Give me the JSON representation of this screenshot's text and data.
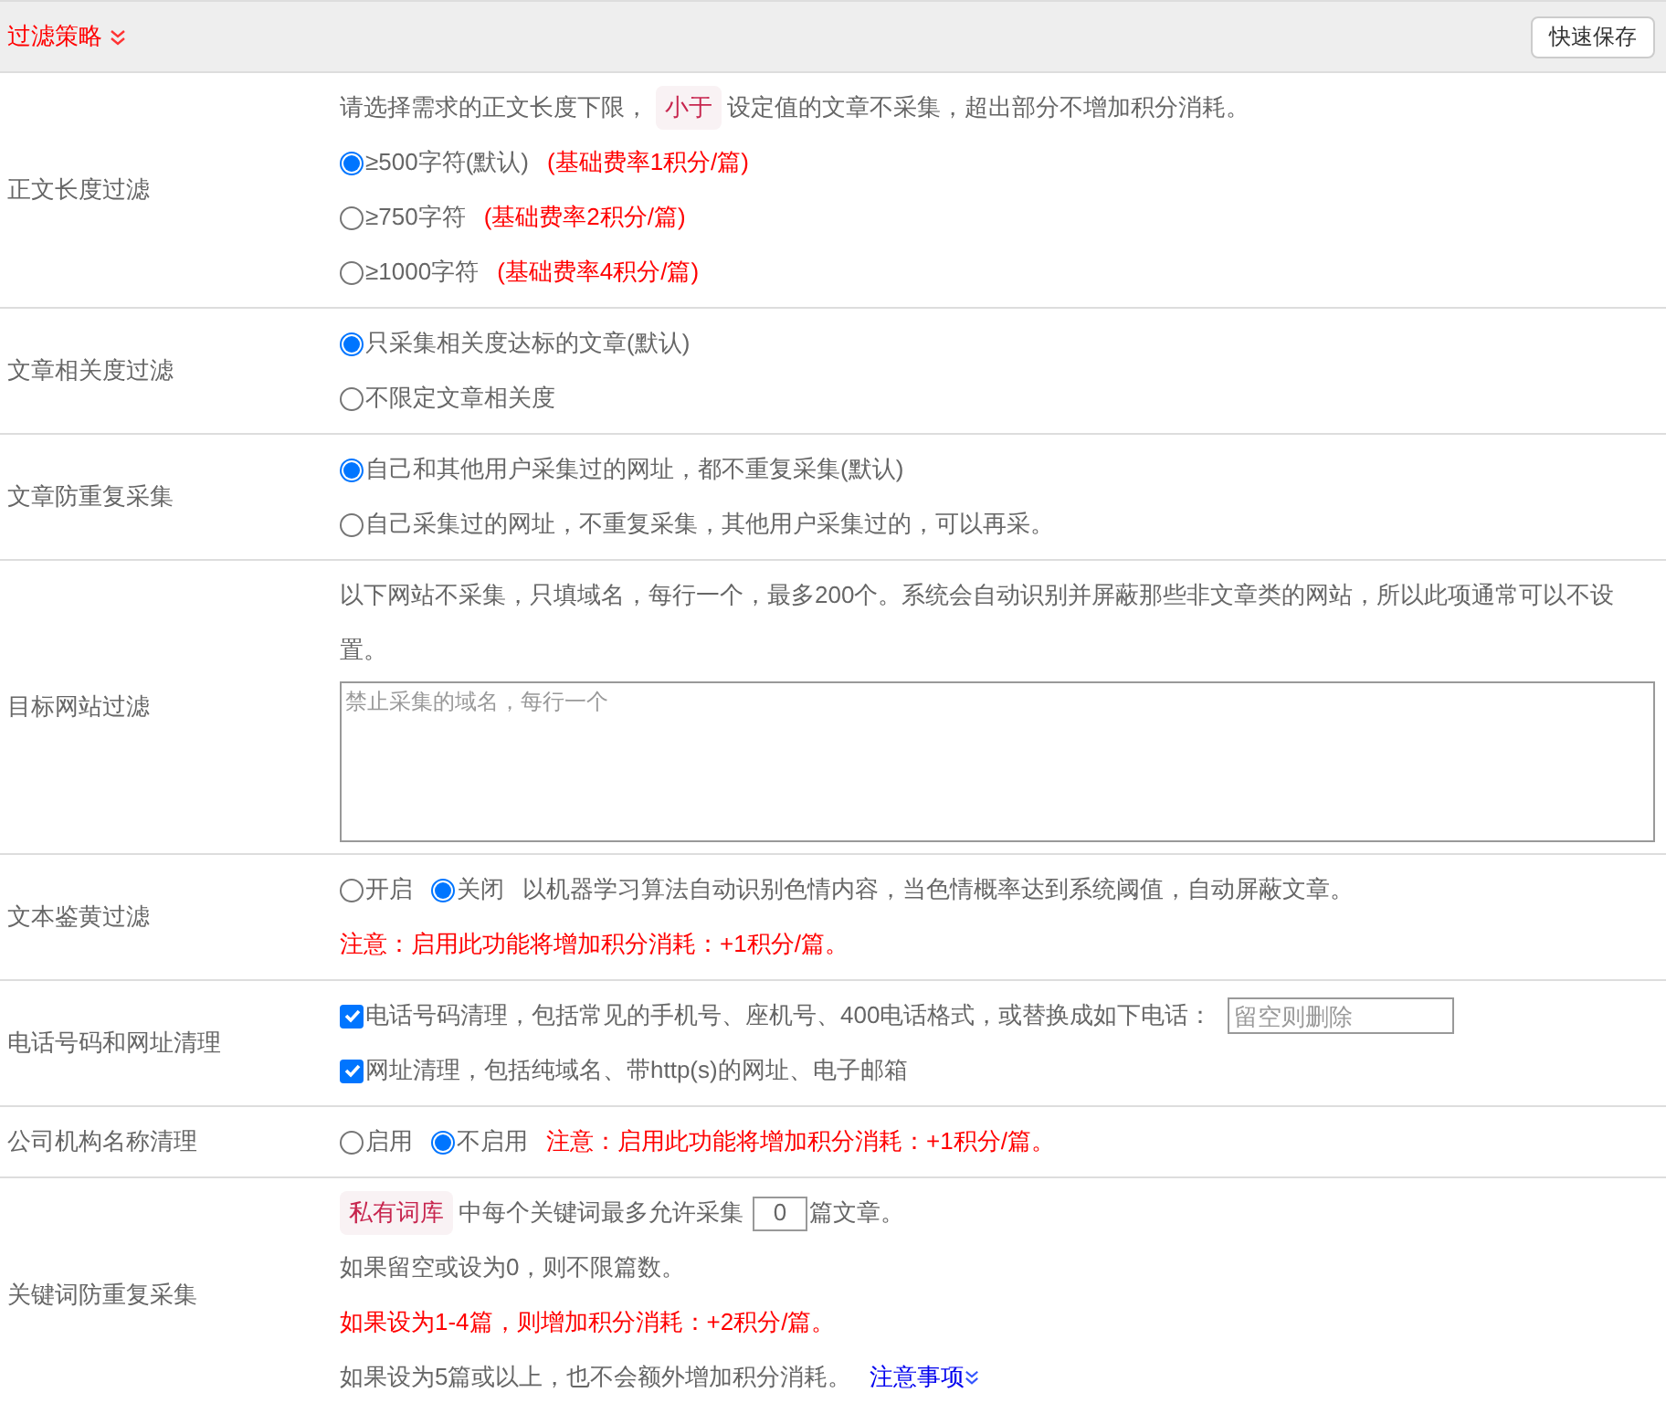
{
  "header": {
    "title": "过滤策略",
    "button": "快速保存"
  },
  "rows": [
    {
      "label": "正文长度过滤",
      "lines": [
        [
          {
            "kind": "text",
            "text": "请选择需求的正文长度下限，"
          },
          {
            "kind": "tag",
            "text": "小于"
          },
          {
            "kind": "text",
            "text": "设定值的文章不采集，超出部分不增加积分消耗。"
          }
        ],
        [
          {
            "kind": "radio",
            "text": "≥500字符(默认)",
            "selected": true
          },
          {
            "kind": "warn",
            "text": "(基础费率1积分/篇)"
          }
        ],
        [
          {
            "kind": "radio",
            "text": "≥750字符",
            "selected": false
          },
          {
            "kind": "warn",
            "text": "(基础费率2积分/篇)"
          }
        ],
        [
          {
            "kind": "radio",
            "text": "≥1000字符",
            "selected": false
          },
          {
            "kind": "warn",
            "text": "(基础费率4积分/篇)"
          }
        ]
      ]
    },
    {
      "label": "文章相关度过滤",
      "lines": [
        [
          {
            "kind": "radio",
            "text": "只采集相关度达标的文章(默认)",
            "selected": true
          }
        ],
        [
          {
            "kind": "radio",
            "text": "不限定文章相关度",
            "selected": false
          }
        ]
      ]
    },
    {
      "label": "文章防重复采集",
      "lines": [
        [
          {
            "kind": "radio",
            "text": "自己和其他用户采集过的网址，都不重复采集(默认)",
            "selected": true
          }
        ],
        [
          {
            "kind": "radio",
            "text": "自己采集过的网址，不重复采集，其他用户采集过的，可以再采。",
            "selected": false
          }
        ]
      ]
    },
    {
      "label": "目标网站过滤",
      "lines": [
        [
          {
            "kind": "text",
            "text": "以下网站不采集，只填域名，每行一个，最多200个。系统会自动识别并屏蔽那些非文章类的网站，所以此项通常可以不设置。"
          }
        ],
        [
          {
            "kind": "textarea",
            "placeholder": "禁止采集的域名，每行一个"
          }
        ]
      ]
    },
    {
      "label": "文本鉴黄过滤",
      "lines": [
        [
          {
            "kind": "radio",
            "text": "开启",
            "selected": false
          },
          {
            "kind": "radio",
            "text": "关闭",
            "selected": true
          },
          {
            "kind": "text",
            "text": "以机器学习算法自动识别色情内容，当色情概率达到系统阈值，自动屏蔽文章。"
          }
        ],
        [
          {
            "kind": "warn",
            "text": "注意：启用此功能将增加积分消耗：+1积分/篇。"
          }
        ]
      ]
    },
    {
      "label": "电话号码和网址清理",
      "lines": [
        [
          {
            "kind": "checkbox",
            "text": "电话号码清理，包括常见的手机号、座机号、400电话格式，或替换成如下电话：",
            "checked": true
          },
          {
            "kind": "input",
            "placeholder": "留空则删除"
          }
        ],
        [
          {
            "kind": "checkbox",
            "text": "网址清理，包括纯域名、带http(s)的网址、电子邮箱",
            "checked": true
          }
        ]
      ]
    },
    {
      "label": "公司机构名称清理",
      "lines": [
        [
          {
            "kind": "radio",
            "text": "启用",
            "selected": false
          },
          {
            "kind": "radio",
            "text": "不启用",
            "selected": true
          },
          {
            "kind": "warn",
            "text": "注意：启用此功能将增加积分消耗：+1积分/篇。"
          }
        ]
      ]
    },
    {
      "label": "关键词防重复采集",
      "lines": [
        [
          {
            "kind": "tag",
            "text": "私有词库"
          },
          {
            "kind": "text",
            "text": "中每个关键词最多允许采集"
          },
          {
            "kind": "number",
            "value": "0"
          },
          {
            "kind": "text",
            "text": "篇文章。"
          }
        ],
        [
          {
            "kind": "text",
            "text": "如果留空或设为0，则不限篇数。"
          }
        ],
        [
          {
            "kind": "warn",
            "text": "如果设为1-4篇，则增加积分消耗：+2积分/篇。"
          }
        ],
        [
          {
            "kind": "text",
            "text": "如果设为5篇或以上，也不会额外增加积分消耗。"
          },
          {
            "kind": "link",
            "text": "注意事项"
          }
        ]
      ]
    }
  ]
}
